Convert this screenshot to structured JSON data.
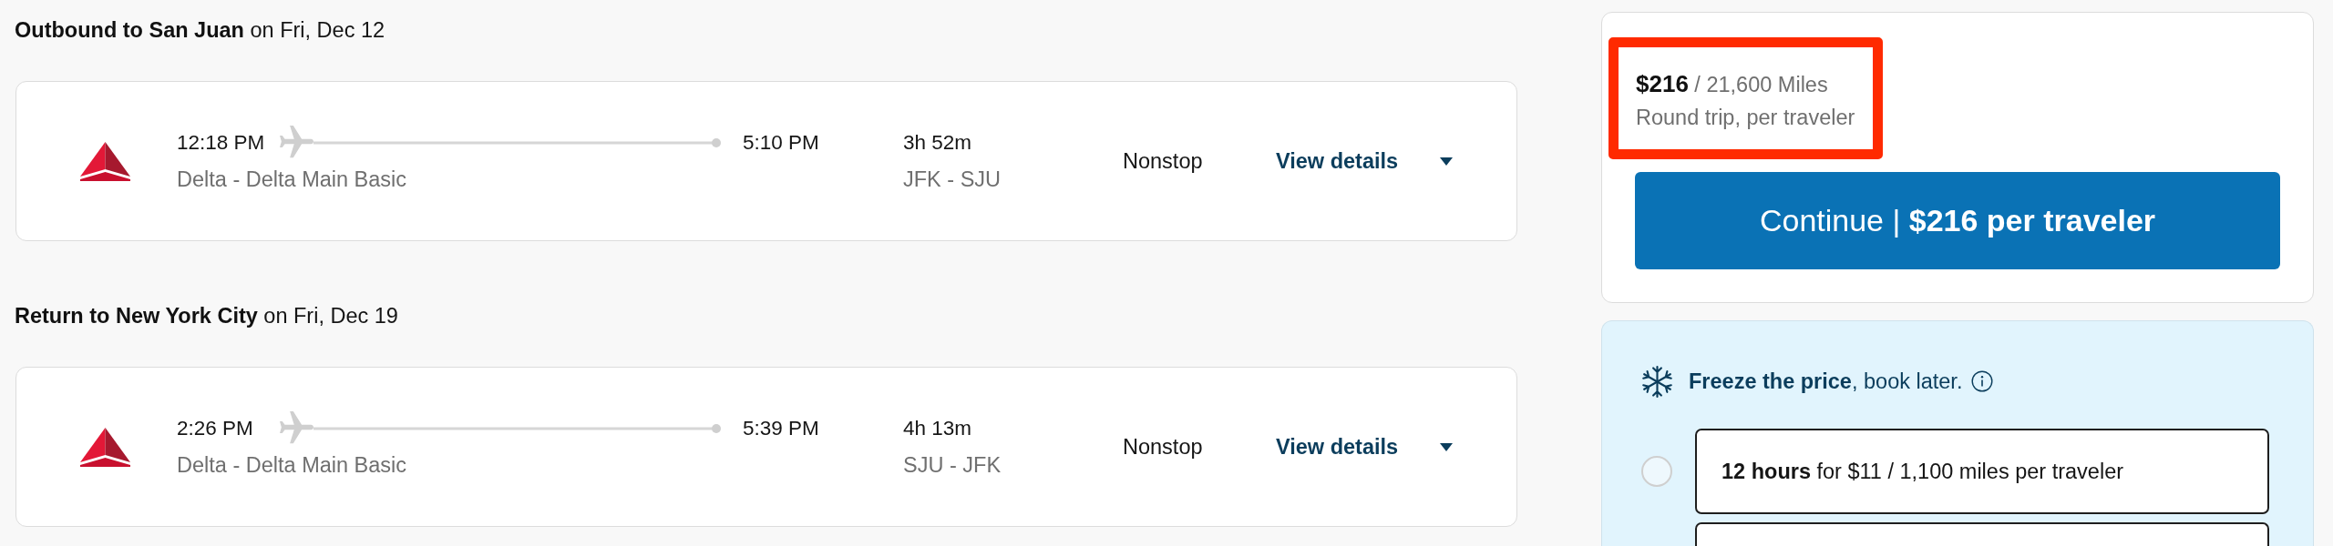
{
  "flights": [
    {
      "heading": "**Outbound to San Juan** on Fri, Dec 12",
      "depart": "12:18 PM",
      "arrive": "5:10 PM",
      "carrier": "Delta - Delta Main Basic",
      "duration": "3h 52m",
      "route": "JFK - SJU",
      "stops": "Nonstop",
      "details_link": "View details",
      "details_expanded": false
    },
    {
      "heading": "**Return to New York City** on Fri, Dec 19",
      "depart": "2:26 PM",
      "arrive": "5:39 PM",
      "carrier": "Delta - Delta Main Basic",
      "duration": "4h 13m",
      "route": "SJU - JFK",
      "stops": "Nonstop",
      "details_link": "View details",
      "details_expanded": false
    }
  ],
  "price": {
    "highlighted": true,
    "amount": "**$216** / 21,600 Miles",
    "note": "Round trip, per traveler",
    "continue_button": "Continue | **$216 per traveler**"
  },
  "freeze": {
    "title": "**Freeze the price**, book later.",
    "options": [
      {
        "kind": "full",
        "label": "**12 hours** for $11 / 1,100 miles per traveler",
        "selected": false
      },
      {
        "kind": "cut_off"
      }
    ]
  }
}
